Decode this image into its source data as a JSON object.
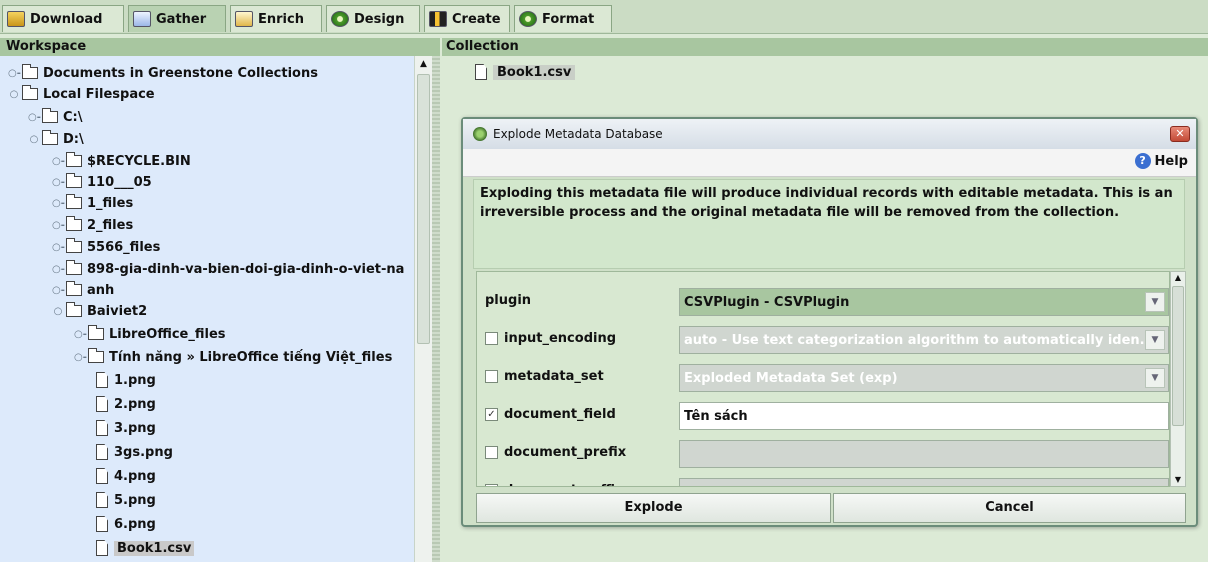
{
  "tabs": [
    {
      "label": "Download",
      "icon": "download-icon",
      "active": false
    },
    {
      "label": "Gather",
      "icon": "gather-icon",
      "active": true
    },
    {
      "label": "Enrich",
      "icon": "enrich-icon",
      "active": false
    },
    {
      "label": "Design",
      "icon": "design-icon",
      "active": false
    },
    {
      "label": "Create",
      "icon": "create-icon",
      "active": false
    },
    {
      "label": "Format",
      "icon": "format-icon",
      "active": false
    }
  ],
  "workspace": {
    "title": "Workspace",
    "tree": [
      {
        "label": "Documents in Greenstone Collections",
        "type": "folder",
        "expanded": false
      },
      {
        "label": "Local Filespace",
        "type": "folder",
        "expanded": true
      },
      {
        "label": "C:\\",
        "type": "folder",
        "expanded": false
      },
      {
        "label": "D:\\",
        "type": "folder",
        "expanded": true
      },
      {
        "label": "$RECYCLE.BIN",
        "type": "folder",
        "expanded": false
      },
      {
        "label": "110___05",
        "type": "folder",
        "expanded": false
      },
      {
        "label": "1_files",
        "type": "folder",
        "expanded": false
      },
      {
        "label": "2_files",
        "type": "folder",
        "expanded": false
      },
      {
        "label": "5566_files",
        "type": "folder",
        "expanded": false
      },
      {
        "label": "898-gia-dinh-va-bien-doi-gia-dinh-o-viet-na",
        "type": "folder",
        "expanded": false
      },
      {
        "label": "anh",
        "type": "folder",
        "expanded": false
      },
      {
        "label": "Baiviet2",
        "type": "folder",
        "expanded": true
      },
      {
        "label": "LibreOffice_files",
        "type": "folder",
        "expanded": false
      },
      {
        "label": "Tính năng » LibreOffice tiếng Việt_files",
        "type": "folder",
        "expanded": false
      },
      {
        "label": "1.png",
        "type": "file"
      },
      {
        "label": "2.png",
        "type": "file"
      },
      {
        "label": "3.png",
        "type": "file"
      },
      {
        "label": "3gs.png",
        "type": "file"
      },
      {
        "label": "4.png",
        "type": "file"
      },
      {
        "label": "5.png",
        "type": "file"
      },
      {
        "label": "6.png",
        "type": "file"
      },
      {
        "label": "Book1.csv",
        "type": "file",
        "selected": true
      }
    ]
  },
  "collection": {
    "title": "Collection",
    "file": "Book1.csv"
  },
  "dialog": {
    "title": "Explode Metadata Database",
    "close_glyph": "✕",
    "help_label": "Help",
    "help_glyph": "?",
    "message": "Exploding this metadata file will produce individual records with editable metadata. This is an irreversible process and the original metadata file will be removed from the collection.",
    "options": [
      {
        "name": "plugin",
        "value": "CSVPlugin - CSVPlugin",
        "checkbox": false,
        "checked": false,
        "control": "active-dropdown"
      },
      {
        "name": "input_encoding",
        "value": "auto - Use text categorization algorithm to automatically iden...",
        "checkbox": true,
        "checked": false,
        "control": "disabled-dropdown"
      },
      {
        "name": "metadata_set",
        "value": "Exploded Metadata Set (exp)",
        "checkbox": true,
        "checked": false,
        "control": "disabled-dropdown"
      },
      {
        "name": "document_field",
        "value": "Tên sách",
        "checkbox": true,
        "checked": true,
        "control": "text"
      },
      {
        "name": "document_prefix",
        "value": "",
        "checkbox": true,
        "checked": false,
        "control": "disabled-text"
      },
      {
        "name": "document_suffix",
        "value": "",
        "checkbox": true,
        "checked": false,
        "control": "disabled-text"
      }
    ],
    "explode_label": "Explode",
    "cancel_label": "Cancel"
  },
  "colors": {
    "panel_header": "#a8c6a0",
    "tree_background": "#ddeafb",
    "dialog_background": "#cfe0c8",
    "message_background": "#d2e7cc"
  }
}
